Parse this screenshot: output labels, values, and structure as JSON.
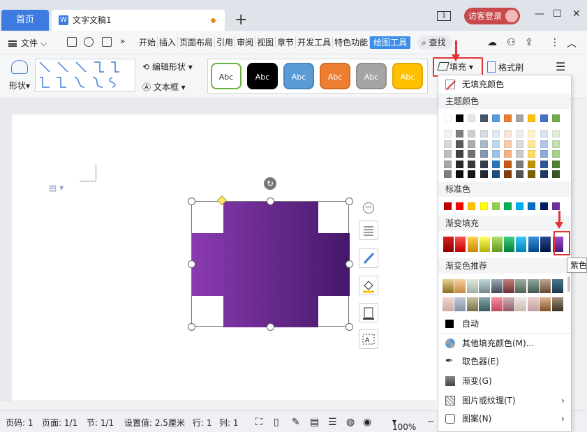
{
  "titlebar": {
    "home_tab": "首页",
    "doc_tab": "文字文稿1",
    "doc_icon": "W",
    "plus": "+",
    "window_count": "1",
    "login": "访客登录",
    "min": "—",
    "max": "☐",
    "close": "✕"
  },
  "menubar": {
    "file": "文件",
    "tabs": [
      "开始",
      "插入",
      "页面布局",
      "引用",
      "审阅",
      "视图",
      "章节",
      "开发工具",
      "特色功能",
      "绘图工具"
    ],
    "active_tab": "绘图工具",
    "search": "查找",
    "more": "»"
  },
  "ribbon": {
    "shape_label": "形状",
    "edit_shape": "编辑形状",
    "text_box": "文本框",
    "styles": [
      {
        "label": "Abc",
        "bg": "#ffffff",
        "fg": "#333333",
        "border": "#6cb33e"
      },
      {
        "label": "Abc",
        "bg": "#000000",
        "fg": "#ffffff",
        "border": "#000000"
      },
      {
        "label": "Abc",
        "bg": "#5b9bd5",
        "fg": "#ffffff",
        "border": "#4a86bf"
      },
      {
        "label": "Abc",
        "bg": "#ed7d31",
        "fg": "#ffffff",
        "border": "#d86c24"
      },
      {
        "label": "Abc",
        "bg": "#a5a5a5",
        "fg": "#ffffff",
        "border": "#8e8e8e"
      },
      {
        "label": "Abc",
        "bg": "#ffc000",
        "fg": "#ffffff",
        "border": "#e0a800"
      }
    ],
    "fill": "填充",
    "format_painter": "格式刷"
  },
  "dropdown": {
    "no_fill": "无填充颜色",
    "theme_colors": "主题颜色",
    "standard_colors": "标准色",
    "gradient_fill": "渐变填充",
    "gradient_recommend": "渐变色推荐",
    "auto": "自动",
    "other_fill": "其他填充颜色(M)...",
    "eyedropper": "取色器(E)",
    "gradient": "渐变(G)",
    "picture_texture": "图片或纹理(T)",
    "pattern": "图案(N)",
    "tooltip": "紫色",
    "theme_top_row": [
      "#ffffff",
      "#000000",
      "#e7e6e6",
      "#44546a",
      "#5b9bd5",
      "#ed7d31",
      "#a5a5a5",
      "#ffc000",
      "#4472c4",
      "#70ad47"
    ],
    "theme_cols": [
      [
        "#f2f2f2",
        "#d9d9d9",
        "#bfbfbf",
        "#a6a6a6",
        "#7f7f7f"
      ],
      [
        "#7f7f7f",
        "#595959",
        "#404040",
        "#262626",
        "#0d0d0d"
      ],
      [
        "#d0cece",
        "#afabab",
        "#757171",
        "#3a3838",
        "#171616"
      ],
      [
        "#d6dce4",
        "#adb9ca",
        "#8497b0",
        "#333f4f",
        "#222a35"
      ],
      [
        "#deebf6",
        "#bdd7ee",
        "#9dc3e6",
        "#2e75b5",
        "#1f4e79"
      ],
      [
        "#fbe5d5",
        "#f8cbad",
        "#f4b183",
        "#c55a11",
        "#843c0b"
      ],
      [
        "#ededed",
        "#dbdbdb",
        "#c9c9c9",
        "#7b7b7b",
        "#525252"
      ],
      [
        "#fff2cc",
        "#ffe699",
        "#ffd966",
        "#bf9000",
        "#7f6000"
      ],
      [
        "#dae3f3",
        "#b4c7e7",
        "#8faadc",
        "#2f5597",
        "#203864"
      ],
      [
        "#e2f0d9",
        "#c5e0b3",
        "#a9d18e",
        "#538135",
        "#375623"
      ]
    ],
    "standard": [
      "#c00000",
      "#ff0000",
      "#ffc000",
      "#ffff00",
      "#92d050",
      "#00b050",
      "#00b0f0",
      "#0070c0",
      "#002060",
      "#7030a0"
    ],
    "gradients": [
      [
        "#d62020",
        "#8c0000"
      ],
      [
        "#ff5050",
        "#c00000"
      ],
      [
        "#ffd24d",
        "#c48a00"
      ],
      [
        "#ffff66",
        "#b3b300"
      ],
      [
        "#b4e06a",
        "#5e9a1e"
      ],
      [
        "#40d080",
        "#00803a"
      ],
      [
        "#40c8f8",
        "#0080b0"
      ],
      [
        "#3a8ed8",
        "#004a8a"
      ],
      [
        "#2a4a90",
        "#001440"
      ],
      [
        "#9a4cc8",
        "#4c1a78"
      ]
    ],
    "recommend_row1": [
      [
        "#e8d090",
        "#8a6d1c"
      ],
      [
        "#f4d0a0",
        "#c88840"
      ],
      [
        "#e0e8e0",
        "#a0b0a0"
      ],
      [
        "#c0d8d8",
        "#708888"
      ],
      [
        "#a0a8b8",
        "#404858"
      ],
      [
        "#c08080",
        "#703030"
      ],
      [
        "#a0b0a0",
        "#506050"
      ],
      [
        "#90a8a0",
        "#405850"
      ],
      [
        "#c0a890",
        "#6a4830"
      ],
      [
        "#4a7890",
        "#1a3850"
      ]
    ],
    "recommend_row2": [
      [
        "#f0d8d0",
        "#d0a8a0"
      ],
      [
        "#c0c8d8",
        "#8890a8"
      ],
      [
        "#c8c0a0",
        "#78704a"
      ],
      [
        "#88a8b0",
        "#385860"
      ],
      [
        "#f090a0",
        "#c04860"
      ],
      [
        "#d0b0b8",
        "#905868"
      ],
      [
        "#f0e8e0",
        "#c8b8b0"
      ],
      [
        "#e8d0d0",
        "#c0a0a0"
      ],
      [
        "#e0b890",
        "#805028"
      ],
      [
        "#a09080",
        "#403020"
      ]
    ]
  },
  "status": {
    "page": "页码: 1",
    "pages": "页面: 1/1",
    "section": "节: 1/1",
    "setting": "设置值: 2.5厘米",
    "row": "行: 1",
    "col": "列: 1",
    "zoom": "100%"
  },
  "shape": {
    "gradient_start": "#8a3ab0",
    "gradient_end": "#45186a"
  }
}
